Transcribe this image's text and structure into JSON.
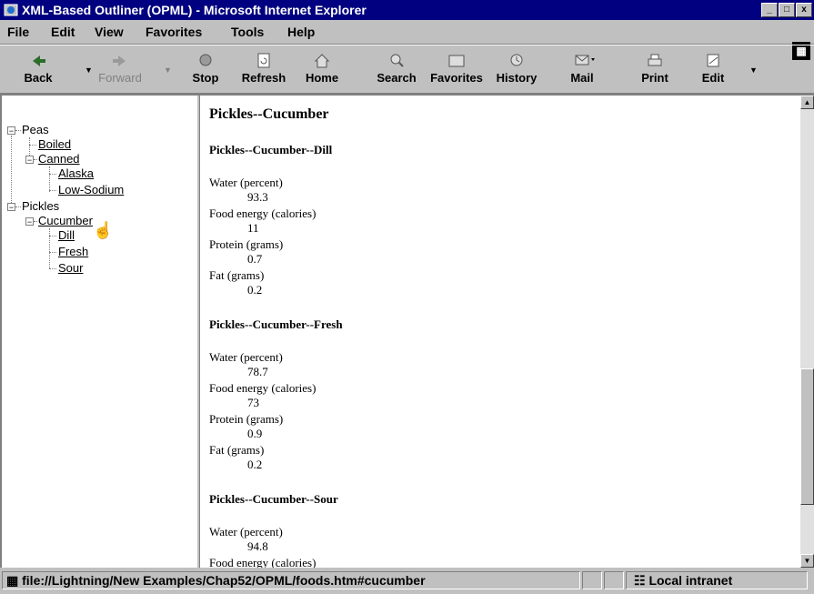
{
  "window": {
    "title": "XML-Based Outliner (OPML) - Microsoft Internet Explorer",
    "controls": [
      "_",
      "□",
      "x"
    ]
  },
  "menu": [
    {
      "label": "File"
    },
    {
      "label": "Edit"
    },
    {
      "label": "View"
    },
    {
      "label": "Favorites"
    },
    {
      "label": "Tools"
    },
    {
      "label": "Help"
    }
  ],
  "toolbar": {
    "back": "Back",
    "forward": "Forward",
    "stop": "Stop",
    "refresh": "Refresh",
    "home": "Home",
    "search": "Search",
    "favorites": "Favorites",
    "history": "History",
    "mail": "Mail",
    "print": "Print",
    "edit": "Edit"
  },
  "tree": {
    "peas": "Peas",
    "boiled": "Boiled",
    "canned": "Canned",
    "alaska": "Alaska",
    "low_sodium": "Low-Sodium",
    "pickles": "Pickles",
    "cucumber": "Cucumber",
    "dill": "Dill",
    "fresh": "Fresh",
    "sour": "Sour",
    "expander_open": "−"
  },
  "content": {
    "heading": "Pickles--Cucumber",
    "sections": [
      {
        "title": "Pickles--Cucumber--Dill",
        "rows": [
          {
            "field": "Water (percent)",
            "value": "93.3"
          },
          {
            "field": "Food energy (calories)",
            "value": "11"
          },
          {
            "field": "Protein (grams)",
            "value": "0.7"
          },
          {
            "field": "Fat (grams)",
            "value": "0.2"
          }
        ]
      },
      {
        "title": "Pickles--Cucumber--Fresh",
        "rows": [
          {
            "field": "Water (percent)",
            "value": "78.7"
          },
          {
            "field": "Food energy (calories)",
            "value": "73"
          },
          {
            "field": "Protein (grams)",
            "value": "0.9"
          },
          {
            "field": "Fat (grams)",
            "value": "0.2"
          }
        ]
      },
      {
        "title": "Pickles--Cucumber--Sour",
        "rows": [
          {
            "field": "Water (percent)",
            "value": "94.8"
          },
          {
            "field": "Food energy (calories)",
            "value": ""
          }
        ]
      }
    ]
  },
  "status": {
    "url": "file://Lightning/New Examples/Chap52/OPML/foods.htm#cucumber",
    "zone": "Local intranet"
  },
  "colors": {
    "title_bar": "#000080",
    "chrome": "#c0c0c0"
  }
}
